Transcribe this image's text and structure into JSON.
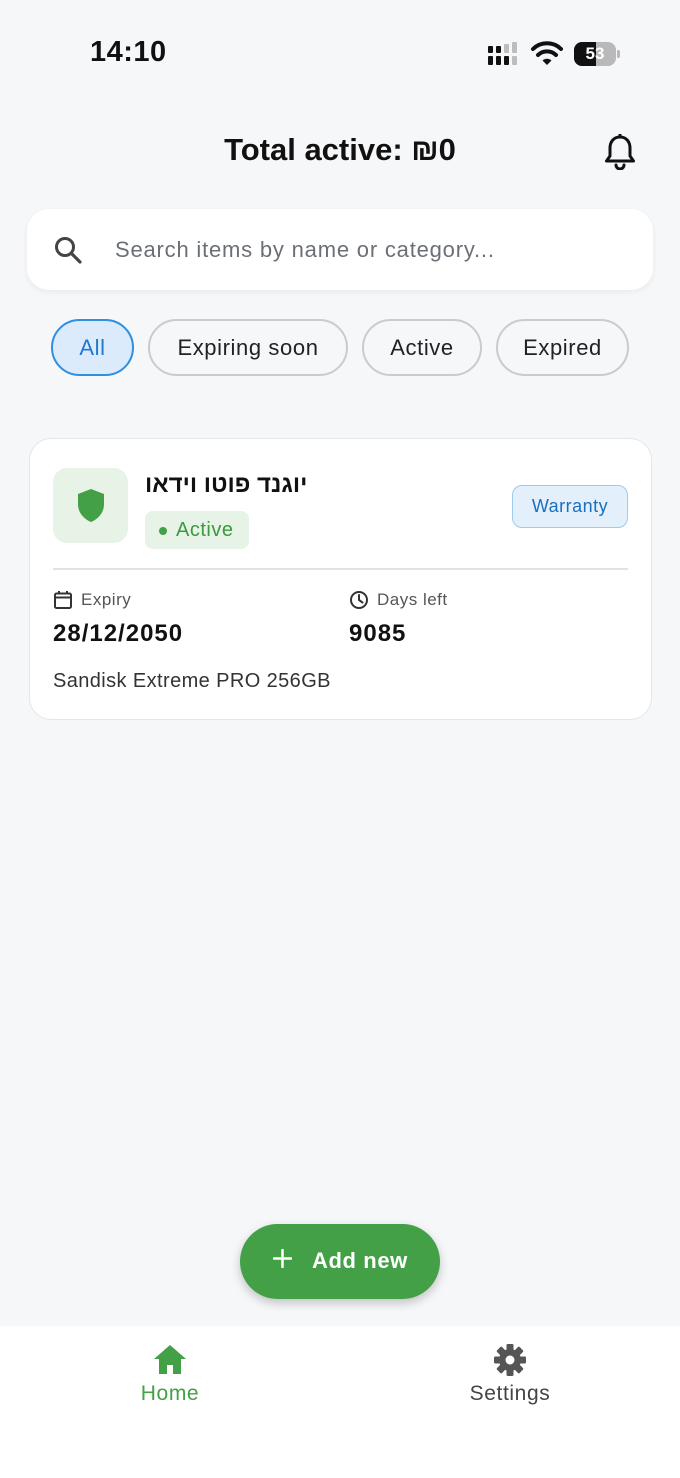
{
  "status_bar": {
    "time": "14:10",
    "battery": "53",
    "battery_level": 0.53
  },
  "header": {
    "title": "Total active: ₪0"
  },
  "search": {
    "placeholder": "Search items by name or category..."
  },
  "filters": [
    {
      "label": "All",
      "selected": true
    },
    {
      "label": "Expiring soon",
      "selected": false
    },
    {
      "label": "Active",
      "selected": false
    },
    {
      "label": "Expired",
      "selected": false
    }
  ],
  "items": [
    {
      "title": "יוגנד פוטו וידאו",
      "status": "Active",
      "type": "Warranty",
      "expiry_label": "Expiry",
      "expiry": "28/12/2050",
      "days_left_label": "Days left",
      "days_left": "9085",
      "description": "Sandisk Extreme PRO 256GB",
      "icon": "shield-icon"
    }
  ],
  "fab": {
    "label": "Add new",
    "icon": "plus-icon"
  },
  "bottom_nav": [
    {
      "label": "Home",
      "icon": "home-icon",
      "active": true
    },
    {
      "label": "Settings",
      "icon": "gear-icon",
      "active": false
    }
  ],
  "colors": {
    "accent_green": "#43a047",
    "chip_selected_bg": "#dcebfb",
    "chip_selected_border": "#2f8fe0",
    "badge_blue": "#1a6fbd",
    "background": "#f6f7f9"
  }
}
